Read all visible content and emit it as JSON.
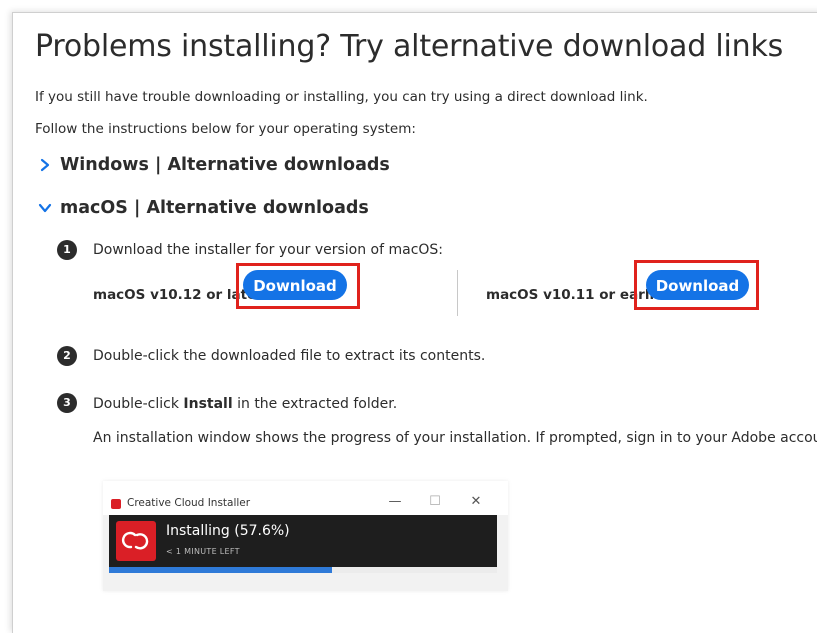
{
  "page": {
    "title": "Problems installing? Try alternative download links",
    "intro_line1": "If you still have trouble downloading or installing, you can try using a direct download link.",
    "intro_line2": "Follow the instructions below for your operating system:"
  },
  "sections": {
    "windows": {
      "label": "Windows | Alternative downloads",
      "expanded": false,
      "icon": "chevron-right-icon"
    },
    "macos": {
      "label": "macOS | Alternative downloads",
      "expanded": true,
      "icon": "chevron-down-icon"
    }
  },
  "steps": [
    {
      "number": "1",
      "text": "Download the installer for your version of macOS:"
    },
    {
      "number": "2",
      "text": "Double-click the downloaded file to extract its contents."
    },
    {
      "number": "3",
      "text_before": "Double-click ",
      "text_bold": "Install",
      "text_after": " in the extracted folder.",
      "note": "An installation window shows the progress of your installation. If prompted, sign in to your Adobe account."
    }
  ],
  "downloads": [
    {
      "os_label": "macOS v10.12 or later",
      "button_label": "Download"
    },
    {
      "os_label": "macOS v10.11 or earlier",
      "button_label": "Download"
    }
  ],
  "installer": {
    "window_title": "Creative Cloud Installer",
    "status": "Installing (57.6%)",
    "time_left": "< 1 MINUTE LEFT",
    "progress": 0.576,
    "controls": {
      "minimize": "—",
      "maximize": "☐",
      "close": "✕"
    }
  },
  "colors": {
    "accent_blue": "#1473e6",
    "highlight_red": "#e0221c",
    "adobe_red": "#da1f26",
    "text": "#2c2c2c"
  }
}
